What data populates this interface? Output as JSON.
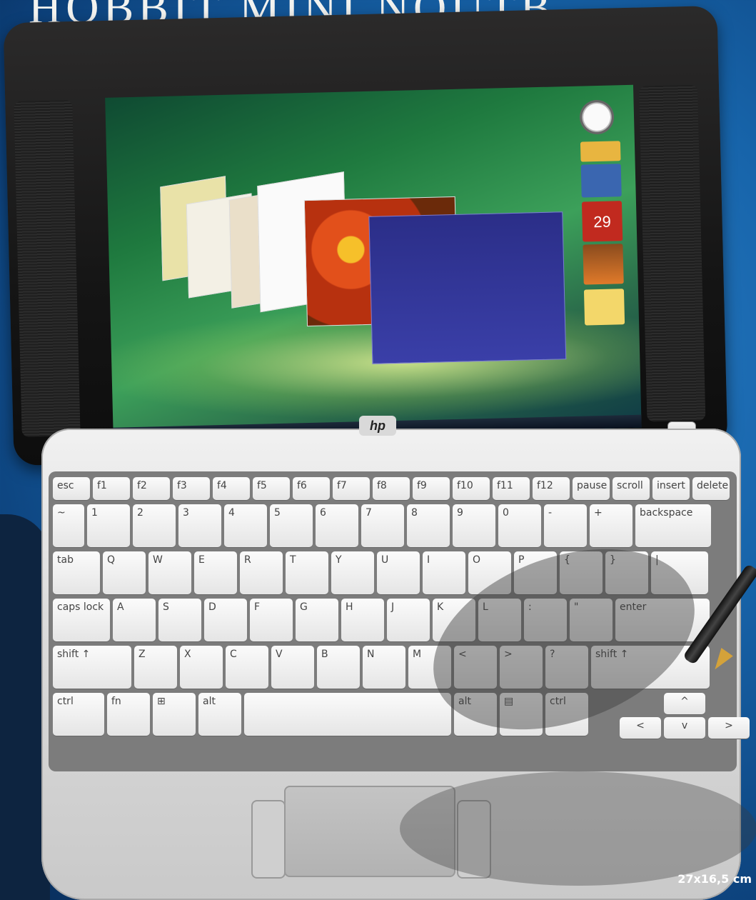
{
  "banner": {
    "title": "HOBBIT MINI NOUTB"
  },
  "screen": {
    "calendar_day": "29"
  },
  "laptop": {
    "brand_logo": "hp"
  },
  "keyboard": {
    "fn_row": [
      "esc",
      "f1",
      "f2",
      "f3",
      "f4",
      "f5",
      "f6",
      "f7",
      "f8",
      "f9",
      "f10",
      "f11",
      "f12",
      "pause",
      "scroll",
      "insert",
      "delete"
    ],
    "num_row": [
      "~",
      "1",
      "2",
      "3",
      "4",
      "5",
      "6",
      "7",
      "8",
      "9",
      "0",
      "-",
      "+",
      "backspace"
    ],
    "row_q": [
      "tab",
      "Q",
      "W",
      "E",
      "R",
      "T",
      "Y",
      "U",
      "I",
      "O",
      "P",
      "{",
      "}",
      "|"
    ],
    "row_a": [
      "caps lock",
      "A",
      "S",
      "D",
      "F",
      "G",
      "H",
      "J",
      "K",
      "L",
      ":",
      "\"",
      "enter"
    ],
    "row_z": [
      "shift ↑",
      "Z",
      "X",
      "C",
      "V",
      "B",
      "N",
      "M",
      "<",
      ">",
      "?",
      "shift ↑"
    ],
    "row_bottom": [
      "ctrl",
      "fn",
      "⊞",
      "alt",
      "",
      "alt",
      "▤",
      "ctrl"
    ],
    "arrows": [
      "^",
      "<",
      "v",
      ">"
    ]
  },
  "dimensions": "27x16,5 cm"
}
